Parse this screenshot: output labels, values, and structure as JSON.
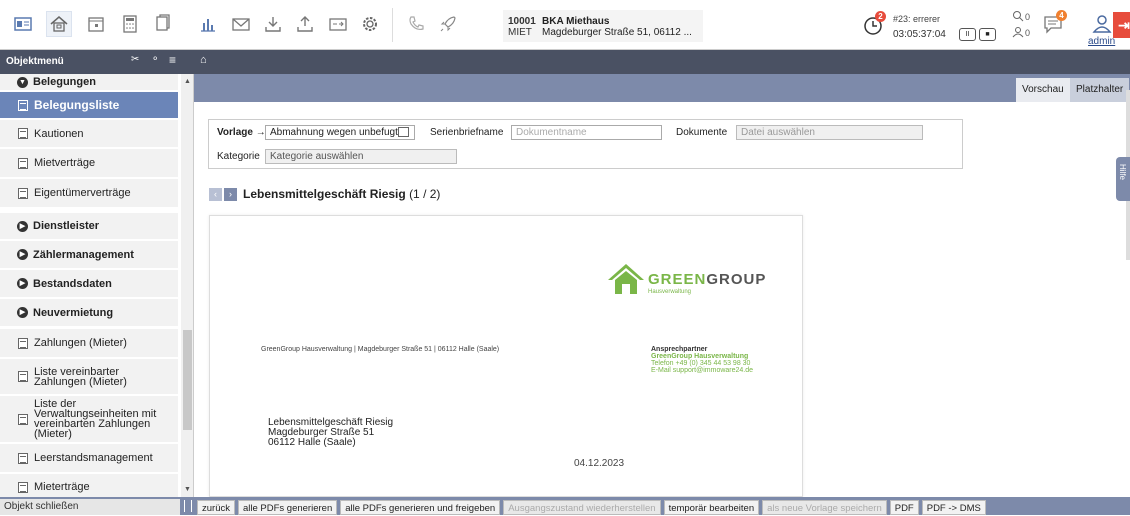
{
  "topbar": {
    "object_number": "10001",
    "object_type": "MIET",
    "object_title": "BKA Miethaus",
    "object_address": "Magdeburger Straße 51, 06112 ...",
    "timer": {
      "badge": "2",
      "ticket": "#23: errerer",
      "time": "03:05:37:04",
      "pause_label": "II",
      "stop_label": "■"
    },
    "count_1": "0",
    "count_2": "0",
    "messages_badge": "4",
    "user": "admin"
  },
  "menubar": {
    "title": "Objektmenü"
  },
  "sidebar": {
    "items": [
      {
        "label": "Belegungen",
        "type": "group-open"
      },
      {
        "label": "Belegungsliste",
        "type": "active"
      },
      {
        "label": "Kautionen",
        "type": "item"
      },
      {
        "label": "Mietverträge",
        "type": "item"
      },
      {
        "label": "Eigentümerverträge",
        "type": "item"
      },
      {
        "label": "Dienstleister",
        "type": "group"
      },
      {
        "label": "Zählermanagement",
        "type": "group"
      },
      {
        "label": "Bestandsdaten",
        "type": "group"
      },
      {
        "label": "Neuvermietung",
        "type": "group"
      },
      {
        "label": "Zahlungen (Mieter)",
        "type": "item"
      },
      {
        "label": "Liste vereinbarter Zahlungen (Mieter)",
        "type": "item"
      },
      {
        "label": "Liste der Verwaltungseinheiten mit vereinbarten Zahlungen (Mieter)",
        "type": "item"
      },
      {
        "label": "Leerstandsmanagement",
        "type": "item"
      },
      {
        "label": "Mieterträge",
        "type": "item"
      }
    ]
  },
  "main": {
    "tabs": [
      "Vorschau",
      "Platzhalter"
    ],
    "form": {
      "vorlage_label": "Vorlage →",
      "vorlage_value": "Abmahnung wegen unbefugt...",
      "serienbrief_label": "Serienbriefname",
      "serienbrief_placeholder": "Dokumentname",
      "dokumente_label": "Dokumente",
      "dokumente_placeholder": "Datei auswählen",
      "kategorie_label": "Kategorie",
      "kategorie_placeholder": "Kategorie auswählen"
    },
    "document": {
      "heading": "Lebensmittelgeschäft Riesig",
      "counter": "(1 / 2)",
      "logo_green": "GREEN",
      "logo_dark": "GROUP",
      "logo_sub": "Hausverwaltung",
      "sender_line": "GreenGroup Hausverwaltung | Magdeburger Straße 51 | 06112 Halle (Saale)",
      "contact_title": "Ansprechpartner",
      "contact_company": "GreenGroup Hausverwaltung",
      "contact_phone": "Telefon +49 (0) 345 44 53 98 30",
      "contact_email": "E-Mail support@immoware24.de",
      "recipient_name": "Lebensmittelgeschäft Riesig",
      "recipient_street": "Magdeburger Straße 51",
      "recipient_city": "06112 Halle (Saale)",
      "date": "04.12.2023"
    },
    "hilfe": "Hilfe"
  },
  "bottombar": {
    "close_label": "Objekt schließen",
    "buttons": [
      {
        "label": "zurück",
        "enabled": true
      },
      {
        "label": "alle PDFs generieren",
        "enabled": true
      },
      {
        "label": "alle PDFs generieren und freigeben",
        "enabled": true
      },
      {
        "label": "Ausgangszustand wiederherstellen",
        "enabled": false
      },
      {
        "label": "temporär bearbeiten",
        "enabled": true
      },
      {
        "label": "als neue Vorlage speichern",
        "enabled": false
      },
      {
        "label": "PDF",
        "enabled": true
      },
      {
        "label": "PDF -> DMS",
        "enabled": true
      }
    ]
  },
  "colors": {
    "menubar": "#4a5163",
    "accent": "#7d8aaa",
    "active_item": "#6b85b8",
    "brand_green": "#7ab648",
    "badge_red": "#e74c3c"
  }
}
